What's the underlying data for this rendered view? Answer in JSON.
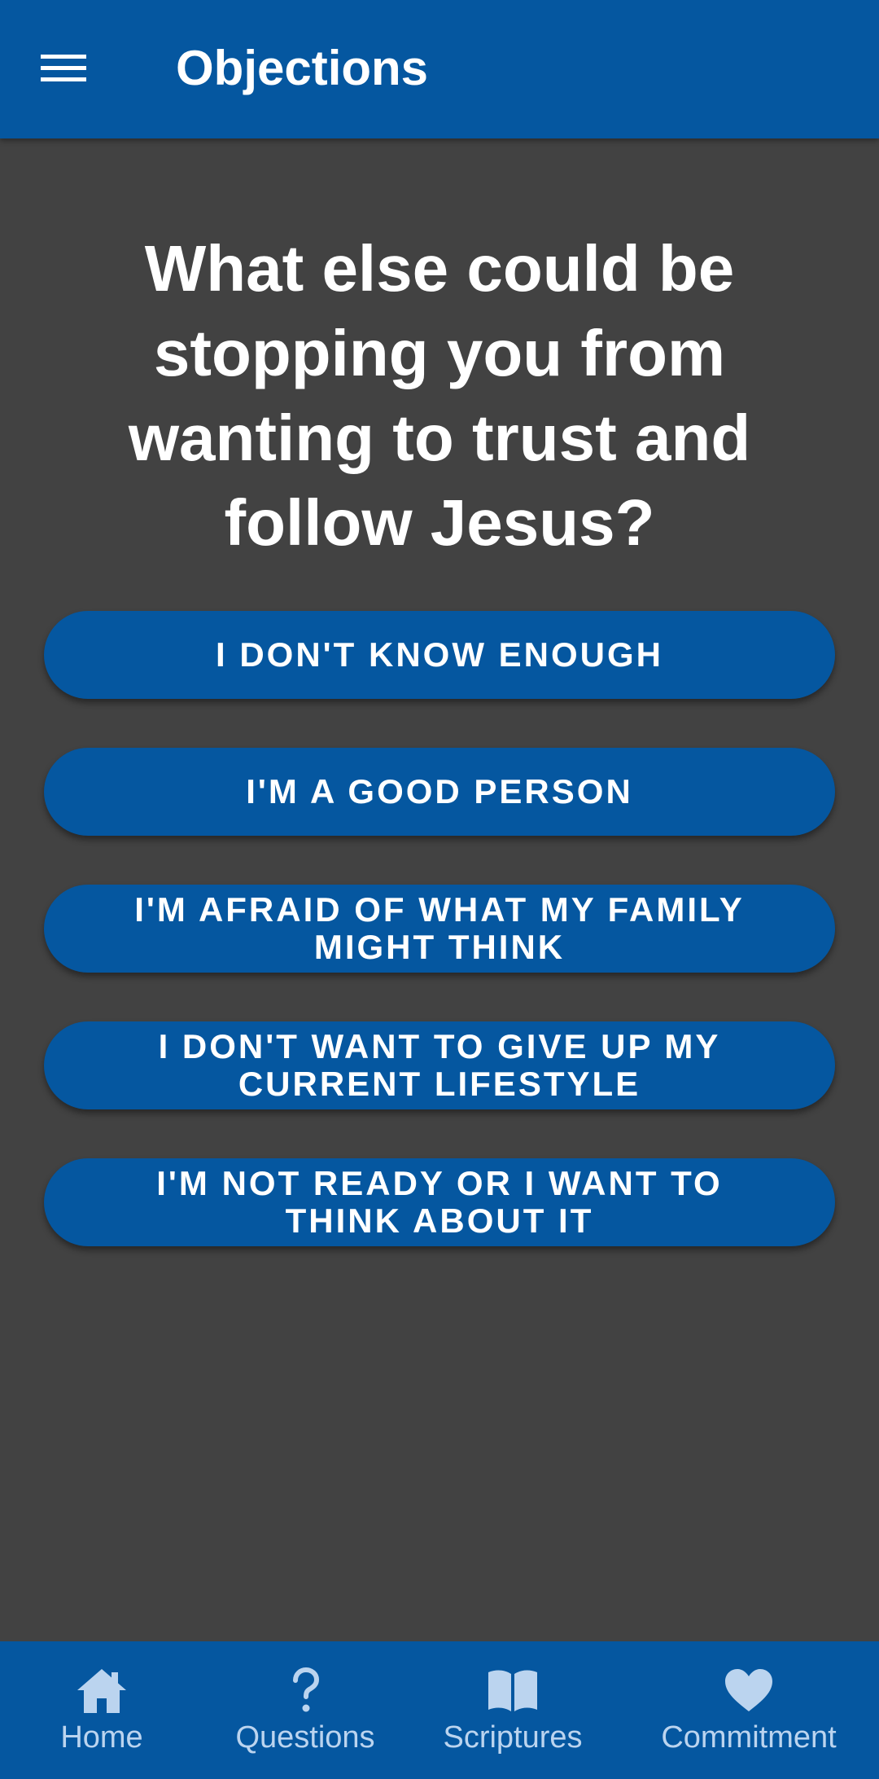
{
  "app_bar": {
    "title": "Objections",
    "menu_icon": "hamburger-menu-icon",
    "background": "#0557A0"
  },
  "question": {
    "text": "What else could be stopping you from wanting to trust and follow Jesus?"
  },
  "options": [
    {
      "label": "I DON'T KNOW ENOUGH"
    },
    {
      "label": "I'M A GOOD PERSON"
    },
    {
      "label": "I'M AFRAID OF WHAT MY FAMILY MIGHT THINK"
    },
    {
      "label": "I DON'T WANT TO GIVE UP MY CURRENT LIFESTYLE"
    },
    {
      "label": "I'M NOT READY OR I WANT TO THINK ABOUT IT"
    }
  ],
  "bottom_nav": {
    "items": [
      {
        "label": "Home",
        "icon": "home-icon"
      },
      {
        "label": "Questions",
        "icon": "question-mark-icon"
      },
      {
        "label": "Scriptures",
        "icon": "open-book-icon"
      },
      {
        "label": "Commitment",
        "icon": "heart-icon"
      }
    ]
  },
  "colors": {
    "primary": "#0557A0",
    "page_background": "#424242",
    "text": "#FFFFFF",
    "nav_inactive": "#BBD4EF"
  }
}
